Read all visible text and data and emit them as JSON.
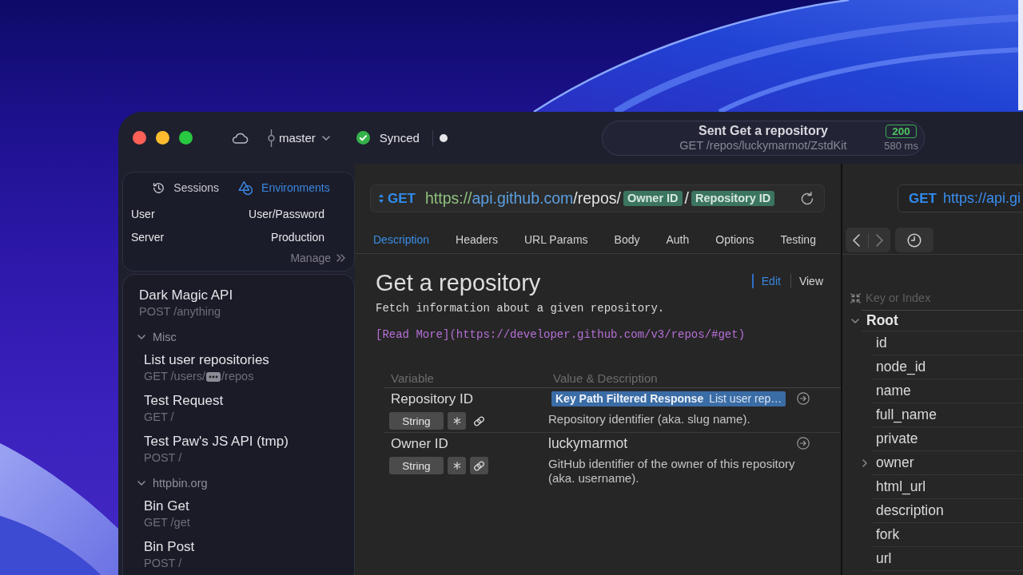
{
  "toolbar": {
    "branch": "master",
    "sync_status": "Synced",
    "activity": {
      "title": "Sent Get a repository",
      "subtitle": "GET /repos/luckymarmot/ZstdKit",
      "status_code": "200",
      "duration": "580 ms"
    }
  },
  "sidebar": {
    "tabs": [
      {
        "kind": "sessions",
        "label": "Sessions",
        "selected": false
      },
      {
        "kind": "environments",
        "label": "Environments",
        "selected": true
      }
    ],
    "environment": [
      {
        "label": "User",
        "value": "User/Password"
      },
      {
        "label": "Server",
        "value": "Production"
      }
    ],
    "manage": "Manage",
    "requests": [
      {
        "kind": "request",
        "name": "Dark Magic API",
        "subtitle": [
          {
            "kind": "text",
            "text": "POST /anything"
          }
        ]
      },
      {
        "kind": "group",
        "name": "Misc",
        "expanded": true,
        "children": [
          {
            "kind": "request",
            "name": "List user repositories",
            "subtitle": [
              {
                "kind": "text",
                "text": "GET /users/"
              },
              {
                "kind": "token"
              },
              {
                "kind": "text",
                "text": "/repos"
              }
            ]
          },
          {
            "kind": "request",
            "name": "Test Request",
            "subtitle": [
              {
                "kind": "text",
                "text": "GET /"
              }
            ]
          },
          {
            "kind": "request",
            "name": "Test Paw's JS API (tmp)",
            "subtitle": [
              {
                "kind": "text",
                "text": "POST /"
              }
            ]
          }
        ]
      },
      {
        "kind": "group",
        "name": "httpbin.org",
        "expanded": true,
        "children": [
          {
            "kind": "request",
            "name": "Bin Get",
            "subtitle": [
              {
                "kind": "text",
                "text": "GET /get"
              }
            ]
          },
          {
            "kind": "request",
            "name": "Bin Post",
            "subtitle": [
              {
                "kind": "text",
                "text": "POST /"
              }
            ]
          }
        ]
      }
    ]
  },
  "request": {
    "method": "GET",
    "url": [
      {
        "kind": "scheme",
        "text": "https://"
      },
      {
        "kind": "host",
        "text": "api.github.com"
      },
      {
        "kind": "path",
        "text": "/repos/"
      },
      {
        "kind": "variable",
        "text": "Owner ID"
      },
      {
        "kind": "path",
        "text": "/"
      },
      {
        "kind": "variable",
        "text": "Repository ID"
      }
    ],
    "tabs": [
      {
        "label": "Description",
        "selected": true
      },
      {
        "label": "Headers",
        "selected": false
      },
      {
        "label": "URL Params",
        "selected": false
      },
      {
        "label": "Body",
        "selected": false
      },
      {
        "label": "Auth",
        "selected": false
      },
      {
        "label": "Options",
        "selected": false
      },
      {
        "label": "Testing",
        "selected": false
      }
    ],
    "document": {
      "title": "Get a repository",
      "modes": [
        {
          "label": "Edit",
          "selected": true
        },
        {
          "label": "View",
          "selected": false
        }
      ],
      "lines": [
        {
          "kind": "text",
          "text": "Fetch information about a given repository."
        },
        {
          "kind": "link",
          "text": "[Read More](https://developer.github.com/v3/repos/#get)"
        }
      ]
    },
    "variables": {
      "columns": [
        "Variable",
        "Value & Description"
      ],
      "rows": [
        {
          "name": "Repository ID",
          "type": "String",
          "link_active": false,
          "value": {
            "kind": "dynamic",
            "label": "Key Path Filtered Response",
            "detail": "List user rep…"
          },
          "description": "Repository identifier (aka. slug name)."
        },
        {
          "name": "Owner ID",
          "type": "String",
          "link_active": true,
          "value": {
            "kind": "text",
            "text": "luckymarmot"
          },
          "description": "GitHub identifier of the owner of this repository (aka. username)."
        }
      ]
    }
  },
  "response": {
    "method": "GET",
    "url": "https://api.gi",
    "search": {
      "placeholder": "Key or Index"
    },
    "tree": [
      {
        "key": "Root",
        "kind": "object",
        "expanded": true,
        "children": [
          {
            "key": "id",
            "kind": "value"
          },
          {
            "key": "node_id",
            "kind": "value"
          },
          {
            "key": "name",
            "kind": "value"
          },
          {
            "key": "full_name",
            "kind": "value"
          },
          {
            "key": "private",
            "kind": "value"
          },
          {
            "key": "owner",
            "kind": "object",
            "expanded": false
          },
          {
            "key": "html_url",
            "kind": "value"
          },
          {
            "key": "description",
            "kind": "value"
          },
          {
            "key": "fork",
            "kind": "value"
          },
          {
            "key": "url",
            "kind": "value"
          }
        ]
      }
    ]
  }
}
